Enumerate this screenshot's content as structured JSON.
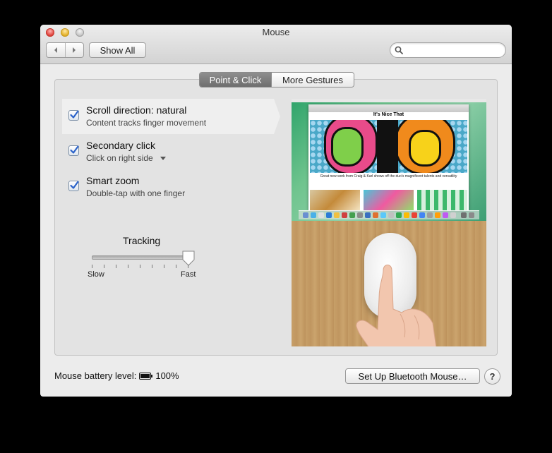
{
  "window": {
    "title": "Mouse",
    "show_all_label": "Show All",
    "search_placeholder": "",
    "back_icon": "chevron-left-icon",
    "forward_icon": "chevron-right-icon"
  },
  "tabs": [
    {
      "label": "Point & Click",
      "active": true
    },
    {
      "label": "More Gestures",
      "active": false
    }
  ],
  "options": [
    {
      "title": "Scroll direction: natural",
      "subtitle": "Content tracks finger movement",
      "checked": true,
      "selected": true
    },
    {
      "title": "Secondary click",
      "subtitle": "Click on right side",
      "checked": true,
      "has_dropdown": true
    },
    {
      "title": "Smart zoom",
      "subtitle": "Double-tap with one finger",
      "checked": true
    }
  ],
  "tracking": {
    "label": "Tracking",
    "min_label": "Slow",
    "max_label": "Fast",
    "value_fraction": 1.0
  },
  "preview": {
    "site_title": "It's Nice That",
    "caption": "Great new work from Craig & Karl shows off the duo's magnificent talents and versatility"
  },
  "footer": {
    "battery_label": "Mouse battery level:",
    "battery_value": "100%",
    "bluetooth_button": "Set Up Bluetooth Mouse…",
    "help_label": "?"
  },
  "colors": {
    "accent_checkbox": "#2a62c9",
    "tab_active": "#7a7a7a"
  }
}
